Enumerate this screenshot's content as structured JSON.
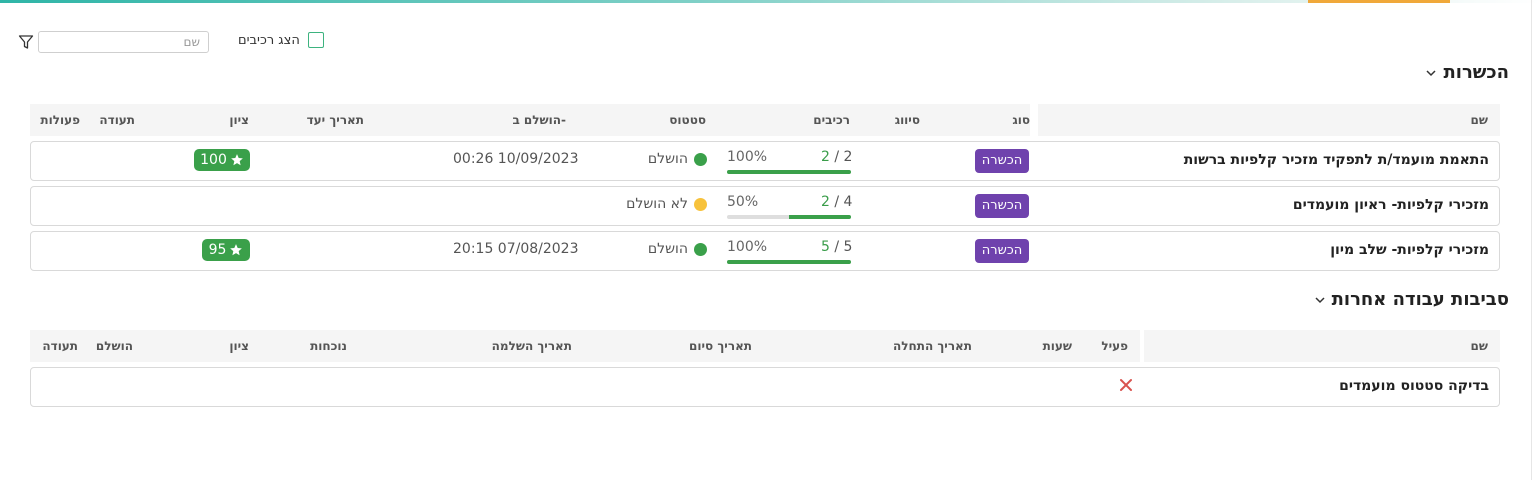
{
  "colors": {
    "accent_teal": "#2fb5a7",
    "accent_orange": "#f0a83a",
    "badge_purple": "#6f42ad",
    "success_green": "#3aa04a",
    "warning_yellow": "#f7c23c",
    "error_red": "#d9534f"
  },
  "filters": {
    "search_placeholder": "שם",
    "show_components_label": "הצג רכיבים",
    "filter_icon": "filter-icon"
  },
  "trainings": {
    "title": "הכשרות",
    "columns": {
      "name": "שם",
      "type": "סוג",
      "category": "סיווג",
      "components": "רכיבים",
      "status": "סטטוס",
      "completed_at": "הושלם ב-",
      "due_date": "תאריך יעד",
      "grade": "ציון",
      "certificate": "תעודה",
      "actions": "פעולות"
    },
    "rows": [
      {
        "name": "התאמת מועמד/ת לתפקיד מזכיר קלפיות ברשות",
        "type": "הכשרה",
        "done": "2",
        "sep": " / ",
        "total": "2",
        "percent": "100%",
        "progress": 1.0,
        "status": "הושלם",
        "status_color": "#3aa04a",
        "completed_at": "00:26 10/09/2023",
        "grade": "100"
      },
      {
        "name": "מזכירי קלפיות- ראיון מועמדים",
        "type": "הכשרה",
        "done": "2",
        "sep": " / ",
        "total": "4",
        "percent": "50%",
        "progress": 0.5,
        "status": "לא הושלם",
        "status_color": "#f7c23c",
        "completed_at": "",
        "grade": ""
      },
      {
        "name": "מזכירי קלפיות- שלב מיון",
        "type": "הכשרה",
        "done": "5",
        "sep": " / ",
        "total": "5",
        "percent": "100%",
        "progress": 1.0,
        "status": "הושלם",
        "status_color": "#3aa04a",
        "completed_at": "20:15 07/08/2023",
        "grade": "95"
      }
    ]
  },
  "environments": {
    "title": "סביבות עבודה אחרות",
    "columns": {
      "name": "שם",
      "active": "פעיל",
      "hours": "שעות",
      "start_date": "תאריך התחלה",
      "end_date": "תאריך סיום",
      "completion_date": "תאריך השלמה",
      "attendance": "נוכחות",
      "grade": "ציון",
      "completed": "הושלם",
      "certificate": "תעודה"
    },
    "rows": [
      {
        "name": "בדיקה סטטוס מועמדים",
        "active_icon": "close-x-icon"
      }
    ]
  }
}
